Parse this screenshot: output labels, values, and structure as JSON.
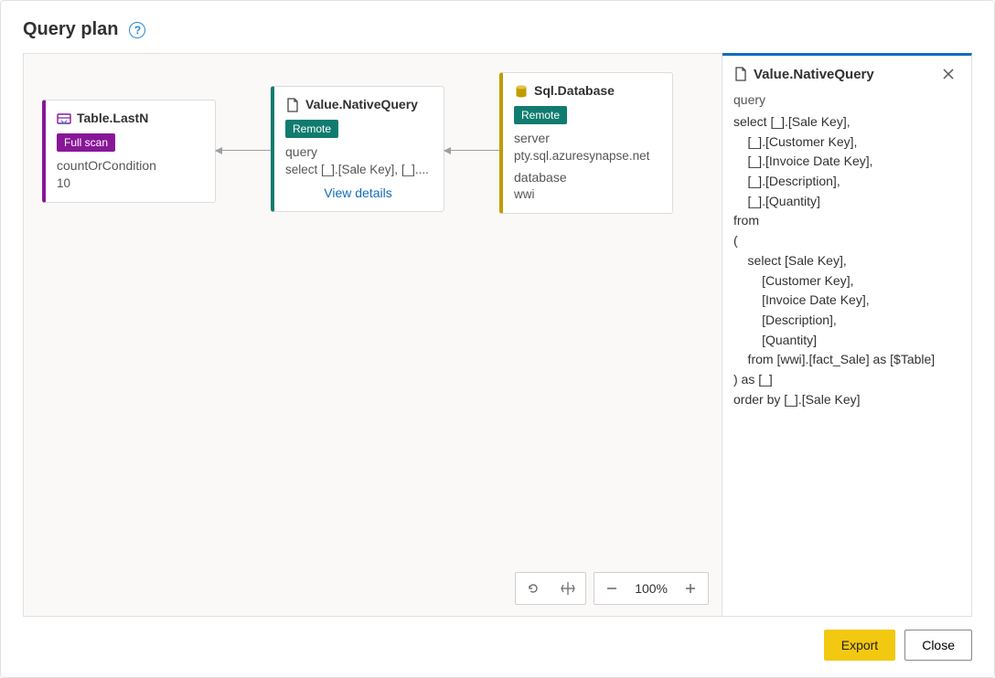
{
  "title": "Query plan",
  "nodes": {
    "tableLastN": {
      "title": "Table.LastN",
      "badge": "Full scan",
      "param_label": "countOrCondition",
      "param_value": "10"
    },
    "nativeQuery": {
      "title": "Value.NativeQuery",
      "badge": "Remote",
      "query_label": "query",
      "query_preview": "select [_].[Sale Key], [_]....",
      "view_details": "View details"
    },
    "sqlDatabase": {
      "title": "Sql.Database",
      "badge": "Remote",
      "server_label": "server",
      "server_value": "pty.sql.azuresynapse.net",
      "database_label": "database",
      "database_value": "wwi"
    }
  },
  "details": {
    "title": "Value.NativeQuery",
    "section_label": "query",
    "query_text": "select [_].[Sale Key],\n    [_].[Customer Key],\n    [_].[Invoice Date Key],\n    [_].[Description],\n    [_].[Quantity]\nfrom \n(\n    select [Sale Key],\n        [Customer Key],\n        [Invoice Date Key],\n        [Description],\n        [Quantity]\n    from [wwi].[fact_Sale] as [$Table]\n) as [_]\norder by [_].[Sale Key]"
  },
  "zoom": {
    "level": "100%"
  },
  "footer": {
    "export": "Export",
    "close": "Close"
  }
}
